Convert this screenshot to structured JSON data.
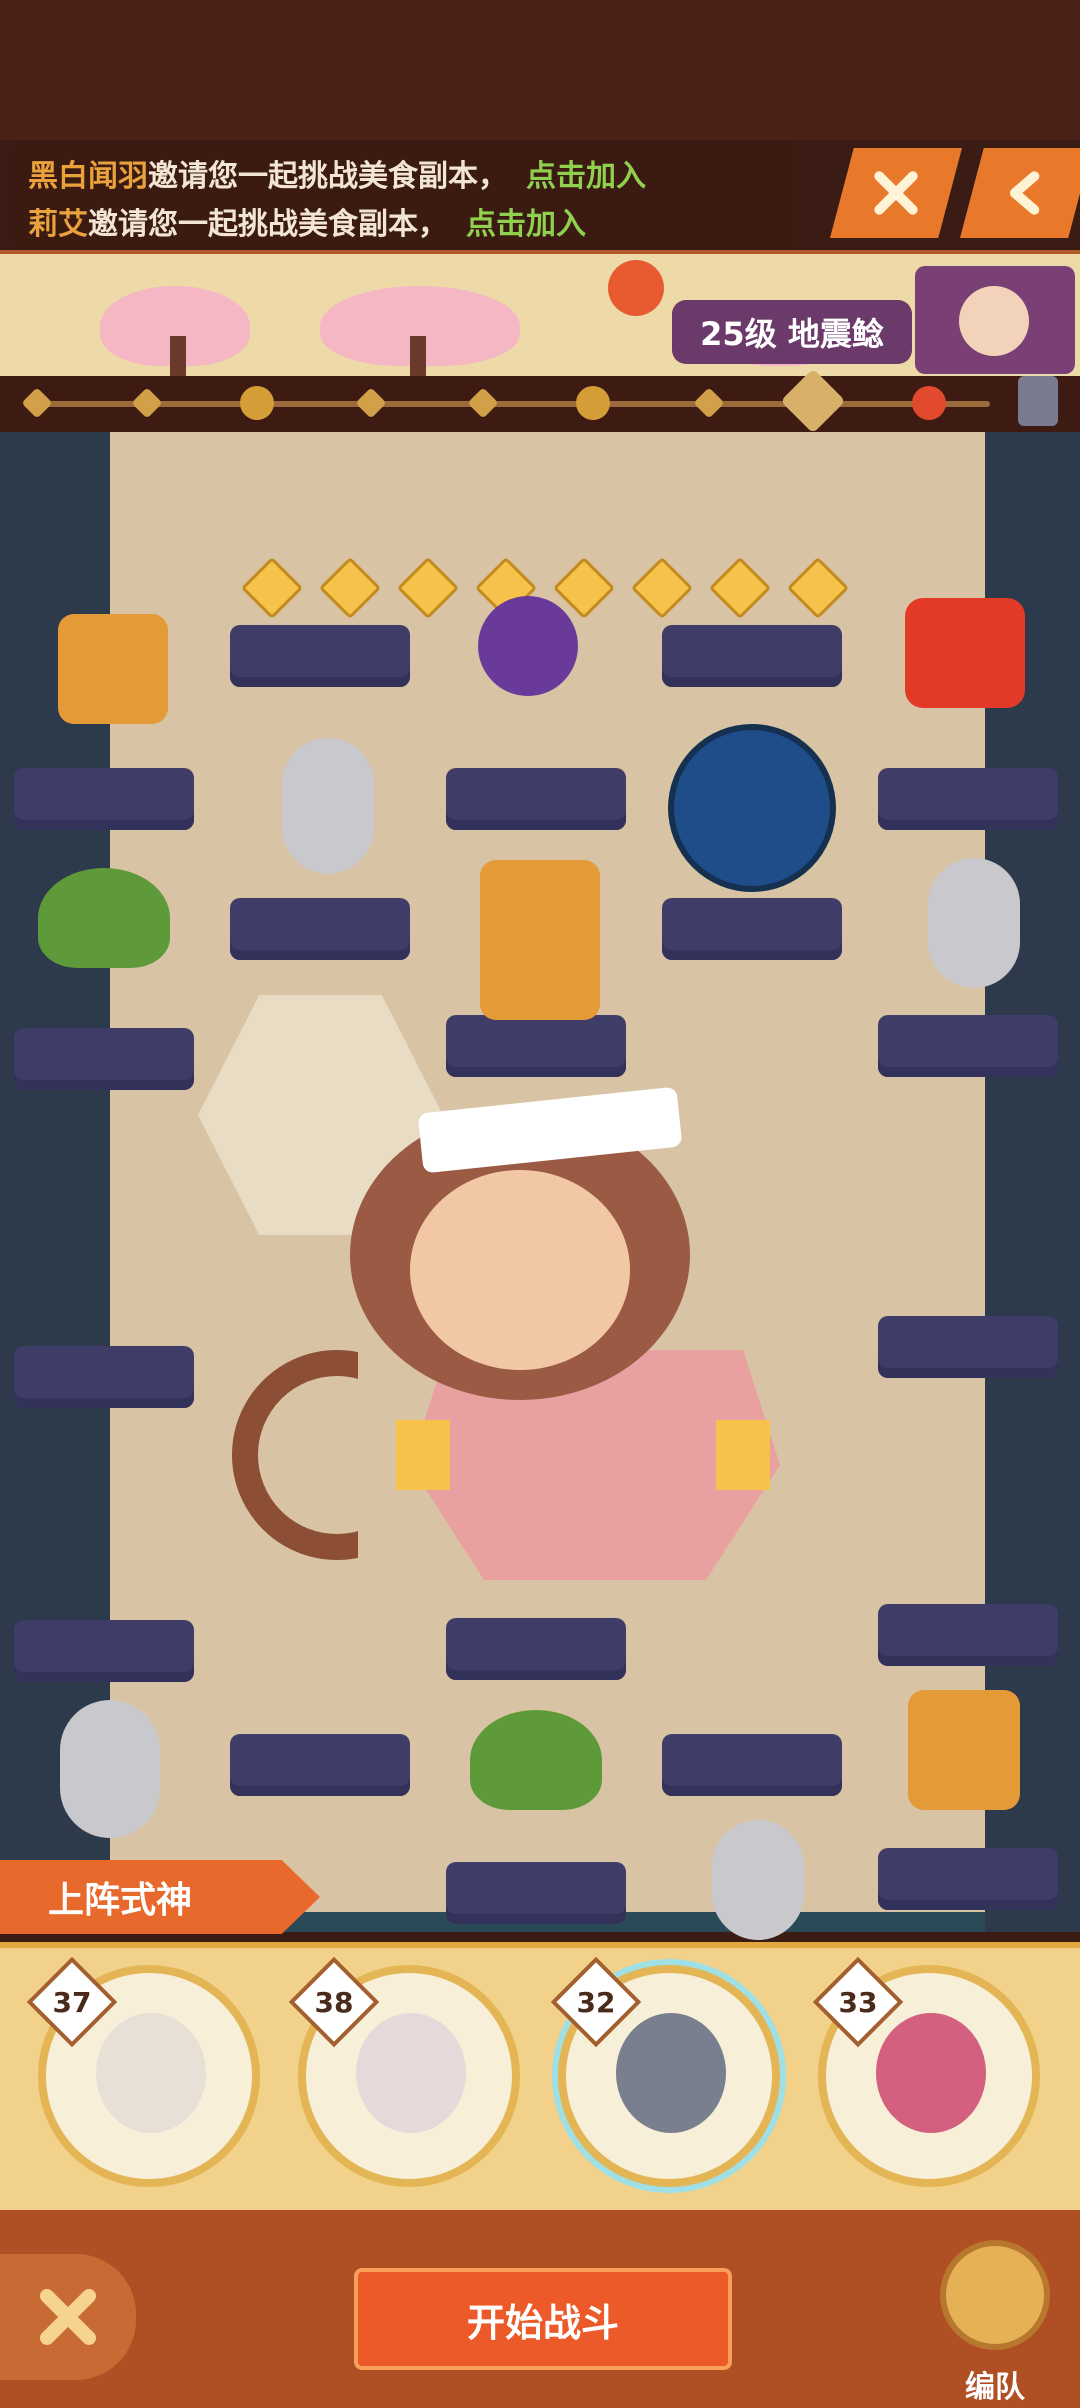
{
  "invites": [
    {
      "name": "黑白闻羽",
      "message": "邀请您一起挑战美食副本，",
      "action": "点击加入"
    },
    {
      "name": "莉艾",
      "message": "邀请您一起挑战美食副本，",
      "action": "点击加入"
    }
  ],
  "header": {
    "close_icon": "close-icon",
    "back_icon": "back-icon"
  },
  "banner": {
    "level_label": "25级 地震鲶"
  },
  "lineup": {
    "title": "上阵式神",
    "heroes": [
      {
        "level": "37"
      },
      {
        "level": "38"
      },
      {
        "level": "32"
      },
      {
        "level": "33"
      }
    ]
  },
  "footer": {
    "start_label": "开始战斗",
    "team_label": "编队"
  },
  "colors": {
    "accent_orange": "#e8692c",
    "invite_name": "#e9a23c",
    "invite_action": "#8fd14f",
    "slot": "#3f3d68"
  }
}
